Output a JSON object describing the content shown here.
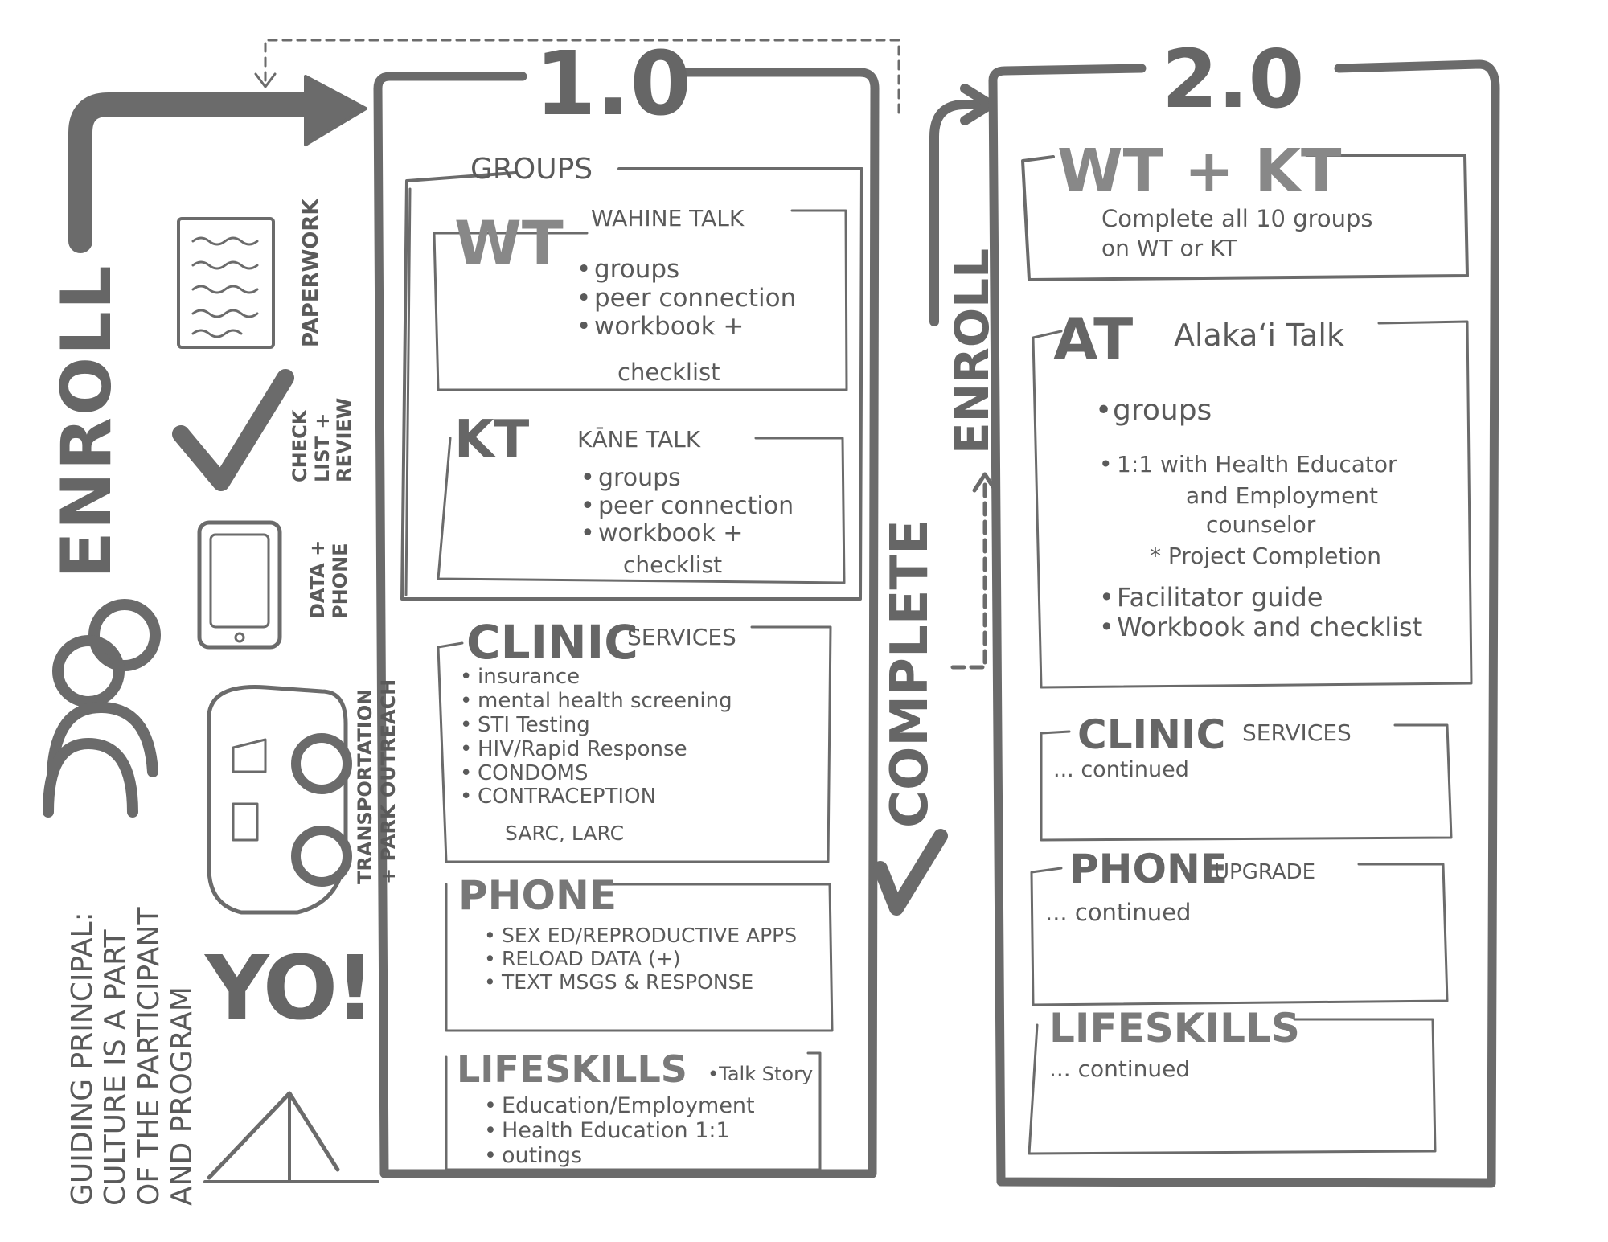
{
  "left": {
    "enroll": "ENROLL",
    "paperwork": "PAPERWORK",
    "checklist_line1": "CHECK",
    "checklist_line2": "LIST +",
    "checklist_line3": "REVIEW",
    "data_line1": "DATA +",
    "data_line2": "PHONE",
    "transport_line1": "TRANSPORTATION",
    "transport_line2": "+ PARK OUTREACH",
    "yo": "YO!",
    "guiding_line1": "GUIDING PRINCIPAL:",
    "guiding_line2": "CULTURE IS A PART",
    "guiding_line3": "OF THE PARTICIPANT",
    "guiding_line4": "AND PROGRAM"
  },
  "v1": {
    "title": "1.0",
    "groups_label": "GROUPS",
    "wt": {
      "abbr": "WT",
      "name": "WAHINE TALK",
      "items": [
        "groups",
        "peer connection",
        "workbook +"
      ],
      "cont": "checklist"
    },
    "kt": {
      "abbr": "KT",
      "name": "KĀNE TALK",
      "items": [
        "groups",
        "peer connection",
        "workbook +"
      ],
      "cont": "checklist"
    },
    "clinic": {
      "title": "CLINIC",
      "subtitle": "SERVICES",
      "items": [
        "insurance",
        "mental health screening",
        "STI Testing",
        "HIV/Rapid Response",
        "CONDOMS",
        "CONTRACEPTION"
      ],
      "cont": "SARC, LARC"
    },
    "phone": {
      "title": "PHONE",
      "items": [
        "SEX ED/REPRODUCTIVE APPS",
        "RELOAD DATA (+)",
        "TEXT MSGS & RESPONSE"
      ]
    },
    "lifeskills": {
      "title": "LIFESKILLS",
      "note": "•Talk Story",
      "items": [
        "Education/Employment",
        "Health Education 1:1",
        "outings"
      ]
    }
  },
  "middle": {
    "complete": "COMPLETE",
    "enroll": "ENROLL"
  },
  "v2": {
    "title": "2.0",
    "wtkt": {
      "title": "WT + KT",
      "line1": "Complete all 10 groups",
      "line2": "on WT or KT"
    },
    "at": {
      "abbr": "AT",
      "name": "Alakaʻi Talk",
      "item1": "groups",
      "item2": "1:1 with Health Educator",
      "item2b": "and Employment",
      "item2c": "counselor",
      "item2d": "* Project Completion",
      "item3": "Facilitator guide",
      "item4": "Workbook and checklist"
    },
    "clinic": {
      "title": "CLINIC",
      "subtitle": "SERVICES",
      "note": "... continued"
    },
    "phone": {
      "title": "PHONE",
      "subtitle": "UPGRADE",
      "note": "... continued"
    },
    "lifeskills": {
      "title": "LIFESKILLS",
      "note": "... continued"
    }
  },
  "colors": {
    "ink": "#666666",
    "paper": "#ffffff"
  }
}
